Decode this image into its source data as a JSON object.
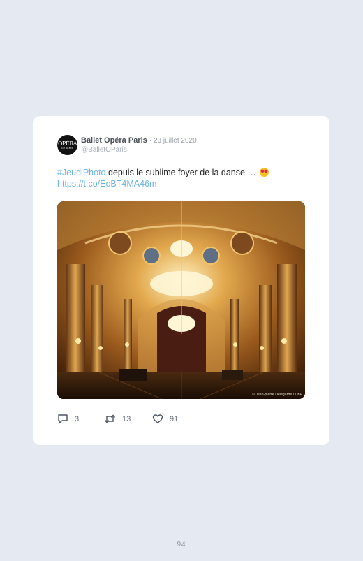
{
  "tweet": {
    "display_name": "Ballet Opéra Paris",
    "date": "· 23 juillet 2020",
    "handle": "@BalletOParis",
    "avatar_text": "OPÉRA",
    "avatar_subtext": "DE PARIS",
    "hashtag": "#JeudiPhoto",
    "body_text": " depuis le sublime foyer de la danse … ",
    "emoji_icon": "star-struck-emoji",
    "link": "https://t.co/EoBT4MA46m",
    "image_credit": "© Jean-pierre Delagarde / OnP",
    "actions": {
      "replies": "3",
      "retweets": "13",
      "likes": "91"
    }
  },
  "page_number": "94",
  "colors": {
    "background": "#e4e9f2",
    "link": "#6cb5e2",
    "card": "#ffffff"
  }
}
